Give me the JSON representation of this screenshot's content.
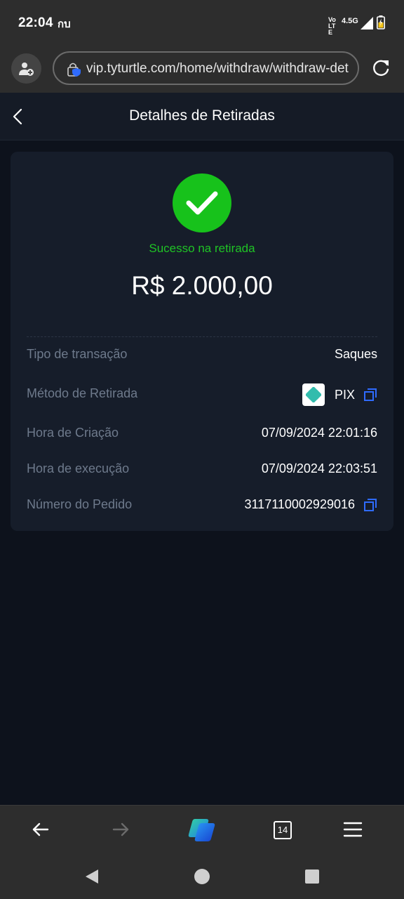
{
  "status_bar": {
    "time": "22:04",
    "carrier": "กบ",
    "volte": "Vo LTE",
    "network": "4.5G"
  },
  "browser": {
    "url": "vip.tyturtle.com/home/withdraw/withdraw-det"
  },
  "header": {
    "title": "Detalhes de Retiradas"
  },
  "summary": {
    "status": "Sucesso na retirada",
    "amount": "R$ 2.000,00"
  },
  "details": {
    "transaction_type_label": "Tipo de transação",
    "transaction_type_value": "Saques",
    "method_label": "Método de Retirada",
    "method_value": "PIX",
    "created_label": "Hora de Criação",
    "created_value": "07/09/2024 22:01:16",
    "executed_label": "Hora de execução",
    "executed_value": "07/09/2024 22:03:51",
    "order_label": "Número do Pedido",
    "order_value": "3117110002929016"
  },
  "bottom_nav": {
    "tabs_count": "14"
  },
  "colors": {
    "success": "#17c21b",
    "accent": "#2f6bff",
    "background": "#0d121c",
    "card": "#161d2a"
  },
  "icons": [
    "back-arrow-icon",
    "forward-arrow-icon",
    "copilot-icon",
    "tabs-icon",
    "menu-icon",
    "copy-icon",
    "pix-icon",
    "check-icon",
    "reload-icon",
    "lock-icon"
  ]
}
